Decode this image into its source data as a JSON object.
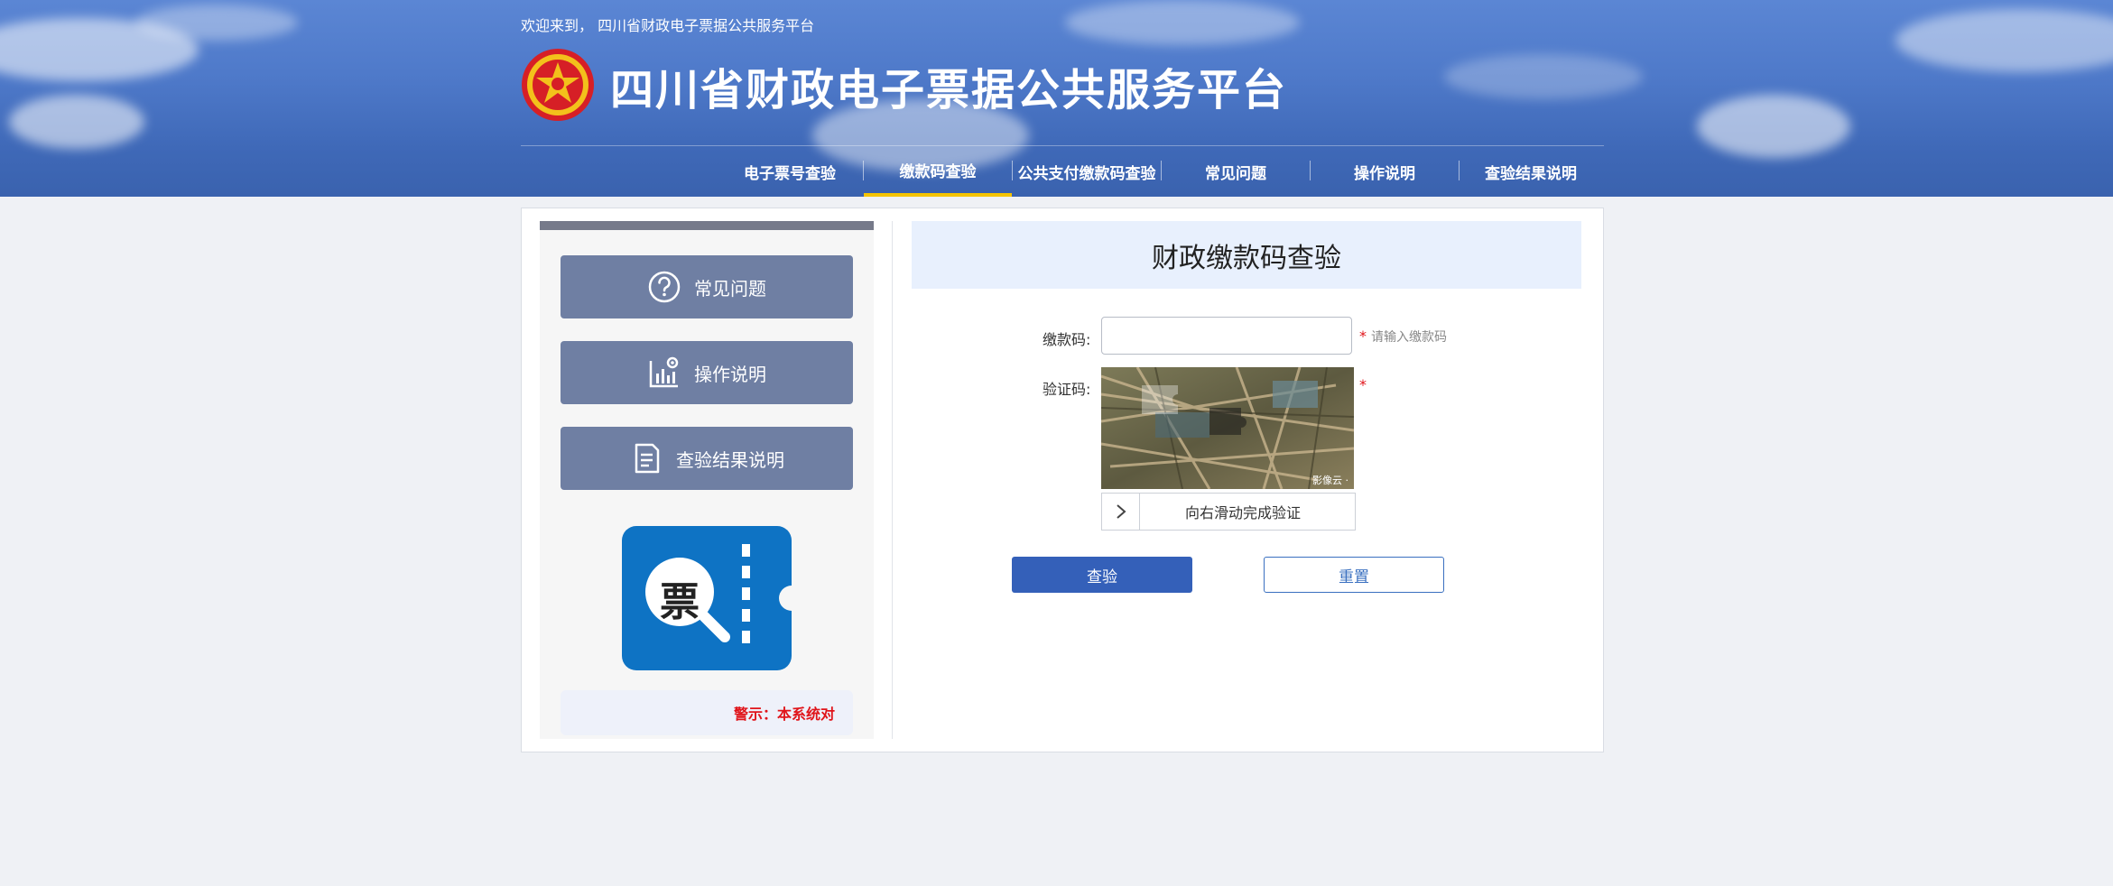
{
  "header": {
    "welcome": "欢迎来到， 四川省财政电子票据公共服务平台",
    "title": "四川省财政电子票据公共服务平台"
  },
  "nav": {
    "items": [
      {
        "label": "电子票号查验"
      },
      {
        "label": "缴款码查验",
        "active": true
      },
      {
        "label": "公共支付缴款码查验"
      },
      {
        "label": "常见问题"
      },
      {
        "label": "操作说明"
      },
      {
        "label": "查验结果说明"
      }
    ]
  },
  "sidebar": {
    "buttons": [
      {
        "label": "常见问题",
        "icon": "question-circle-icon"
      },
      {
        "label": "操作说明",
        "icon": "chart-gear-icon"
      },
      {
        "label": "查验结果说明",
        "icon": "document-icon"
      }
    ],
    "ticket_glyph": "票",
    "notice": "警示：本系统对"
  },
  "form": {
    "title": "财政缴款码查验",
    "code_label": "缴款码:",
    "code_value": "",
    "code_hint": "请输入缴款码",
    "captcha_label": "验证码:",
    "required_mark": "*",
    "captcha_watermark": "影像云 ·",
    "slider_text": "向右滑动完成验证",
    "query_button": "查验",
    "reset_button": "重置"
  },
  "colors": {
    "header_blue": "#4e79c9",
    "nav_active": "#f5c400",
    "side_button": "#6f7fa3",
    "primary_button": "#3460b9",
    "warning_red": "#e0141a"
  }
}
